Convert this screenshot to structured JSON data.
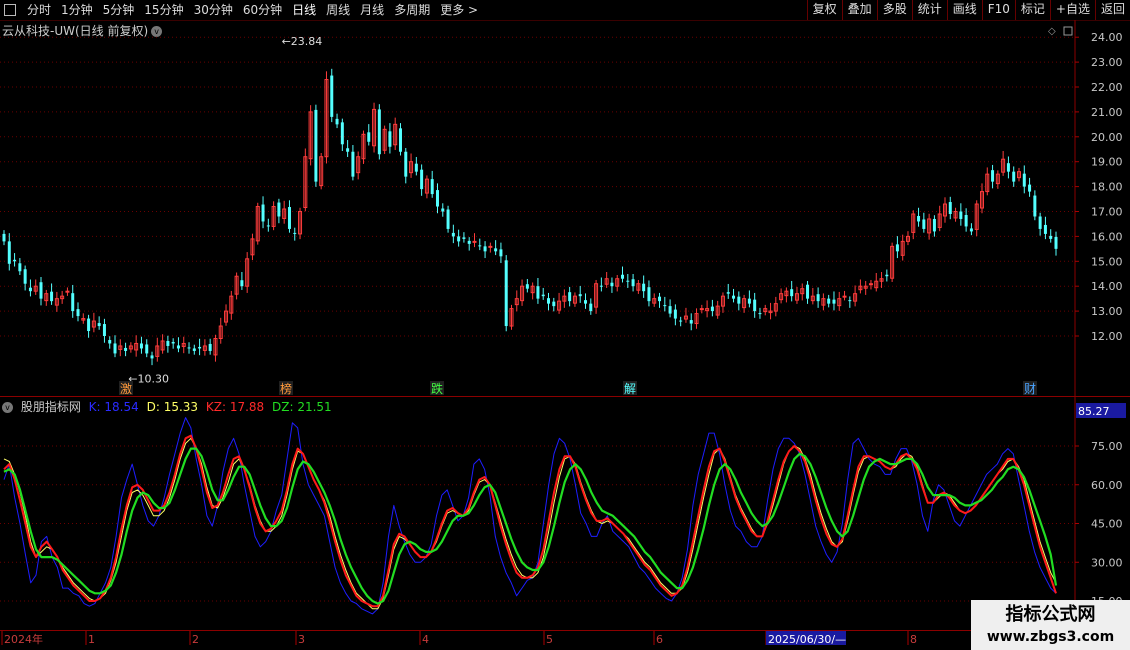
{
  "toolbar": {
    "periods": [
      "分时",
      "1分钟",
      "5分钟",
      "15分钟",
      "30分钟",
      "60分钟",
      "日线",
      "周线",
      "月线",
      "多周期",
      "更多 >"
    ],
    "active_period": "日线",
    "right_buttons": [
      "复权",
      "叠加",
      "多股",
      "统计",
      "画线",
      "F10",
      "标记",
      "+自选",
      "返回"
    ]
  },
  "main_chart": {
    "title": "云从科技-UW(日线 前复权)",
    "high_label": "23.84",
    "low_label": "10.30",
    "event_markers": [
      "激",
      "榜",
      "跌",
      "解",
      "财"
    ]
  },
  "indicator": {
    "name": "股朋指标网",
    "k_label": "K: 18.54",
    "d_label": "D: 15.33",
    "kz_label": "KZ: 17.88",
    "dz_label": "DZ: 21.51",
    "top_value": "85.27"
  },
  "time_axis": {
    "labels": [
      "2024年",
      "1",
      "2",
      "3",
      "4",
      "5",
      "6",
      "2025/06/30/—",
      "8"
    ]
  },
  "watermark": {
    "line1": "指标公式网",
    "line2": "www.zbgs3.com"
  },
  "colors": {
    "up": "#ff3c3c",
    "down": "#54ffff",
    "k": "#1e1eff",
    "d": "#ffff66",
    "kz": "#ff1a1a",
    "dz": "#22dd22"
  },
  "chart_data": [
    {
      "type": "candlestick",
      "title": "云从科技-UW(日线 前复权)",
      "y_ticks": [
        12.0,
        13.0,
        14.0,
        15.0,
        16.0,
        17.0,
        18.0,
        19.0,
        20.0,
        21.0,
        22.0,
        23.0,
        24.0
      ],
      "ylim": [
        10.0,
        24.5
      ],
      "grid": true,
      "annotations": [
        {
          "text": "23.84",
          "value": 23.84,
          "at_index": 51
        },
        {
          "text": "10.30",
          "value": 10.3,
          "at_index": 22
        }
      ],
      "close": [
        15.8,
        14.9,
        15.0,
        14.6,
        14.1,
        13.8,
        14.0,
        13.5,
        13.7,
        13.4,
        13.5,
        13.6,
        13.8,
        13.0,
        12.8,
        12.7,
        12.2,
        12.6,
        12.4,
        12.0,
        11.7,
        11.3,
        11.6,
        11.4,
        11.6,
        11.7,
        11.5,
        11.3,
        11.1,
        11.6,
        11.8,
        11.6,
        11.7,
        11.5,
        11.7,
        11.5,
        11.4,
        11.5,
        11.6,
        11.4,
        11.9,
        12.4,
        13.0,
        13.6,
        14.4,
        14.0,
        15.1,
        15.9,
        17.2,
        16.6,
        16.4,
        17.2,
        16.8,
        17.1,
        16.3,
        16.1,
        17.0,
        19.2,
        21.0,
        18.2,
        19.2,
        22.3,
        20.8,
        20.5,
        19.7,
        19.4,
        18.4,
        19.2,
        20.1,
        19.8,
        21.1,
        19.3,
        20.3,
        19.6,
        20.5,
        19.4,
        18.4,
        19.0,
        18.6,
        17.9,
        18.3,
        17.7,
        17.2,
        17.0,
        16.3,
        16.0,
        15.8,
        15.9,
        15.7,
        15.8,
        15.6,
        15.4,
        15.6,
        15.4,
        15.2,
        12.4,
        13.1,
        13.5,
        14.0,
        13.9,
        14.0,
        13.5,
        13.6,
        13.3,
        13.2,
        13.4,
        13.6,
        13.4,
        13.6,
        13.6,
        13.3,
        13.0,
        14.1,
        14.0,
        14.3,
        14.0,
        14.3,
        14.3,
        14.2,
        14.0,
        14.1,
        13.8,
        13.4,
        13.5,
        13.4,
        13.2,
        12.9,
        12.7,
        12.6,
        12.8,
        12.5,
        12.9,
        13.1,
        13.1,
        13.0,
        13.2,
        13.6,
        13.7,
        13.5,
        13.3,
        13.5,
        13.3,
        13.0,
        12.9,
        13.1,
        13.0,
        13.3,
        13.7,
        13.8,
        13.6,
        13.7,
        13.9,
        13.5,
        13.6,
        13.4,
        13.5,
        13.3,
        13.3,
        13.5,
        13.6,
        13.4,
        13.7,
        14.0,
        14.0,
        14.1,
        14.2,
        14.3,
        14.4,
        15.6,
        15.4,
        15.8,
        16.0,
        16.9,
        16.6,
        16.3,
        16.7,
        16.2,
        16.9,
        17.3,
        16.9,
        17.0,
        16.7,
        16.4,
        16.2,
        17.3,
        17.8,
        18.5,
        18.2,
        18.5,
        19.1,
        18.6,
        18.2,
        18.6,
        18.0,
        17.8,
        16.8,
        16.3,
        16.1,
        15.9,
        15.5
      ]
    },
    {
      "type": "line",
      "title": "股朋指标网",
      "y_ticks": [
        15.0,
        30.0,
        45.0,
        60.0,
        75.0
      ],
      "ylim": [
        8.0,
        85.27
      ],
      "grid": true,
      "series": [
        {
          "name": "K",
          "last": 18.54,
          "values": [
            62,
            68,
            55,
            45,
            33,
            22,
            25,
            38,
            40,
            32,
            28,
            20,
            20,
            18,
            17,
            14,
            13,
            14,
            18,
            22,
            28,
            40,
            55,
            62,
            68,
            60,
            52,
            46,
            44,
            48,
            55,
            64,
            72,
            80,
            86,
            82,
            70,
            60,
            48,
            44,
            52,
            65,
            74,
            78,
            72,
            60,
            50,
            40,
            36,
            38,
            42,
            50,
            56,
            70,
            84,
            82,
            68,
            60,
            56,
            52,
            48,
            38,
            28,
            22,
            18,
            15,
            14,
            12,
            11,
            10,
            12,
            22,
            40,
            52,
            44,
            38,
            33,
            30,
            30,
            32,
            37,
            48,
            56,
            58,
            52,
            46,
            48,
            55,
            68,
            70,
            66,
            56,
            40,
            32,
            26,
            22,
            17,
            20,
            23,
            24,
            30,
            45,
            60,
            72,
            78,
            76,
            70,
            60,
            49,
            45,
            40,
            40,
            45,
            48,
            42,
            40,
            38,
            36,
            32,
            28,
            26,
            23,
            20,
            18,
            16,
            15,
            18,
            24,
            35,
            52,
            64,
            72,
            80,
            80,
            72,
            60,
            50,
            44,
            42,
            38,
            36,
            36,
            40,
            54,
            66,
            74,
            78,
            78,
            76,
            72,
            64,
            54,
            44,
            38,
            33,
            30,
            34,
            45,
            62,
            76,
            78,
            74,
            70,
            68,
            67,
            64,
            64,
            70,
            74,
            74,
            69,
            60,
            48,
            42,
            54,
            60,
            58,
            52,
            46,
            44,
            48,
            52,
            56,
            60,
            64,
            66,
            68,
            72,
            74,
            72,
            62,
            52,
            42,
            34,
            28,
            24,
            20,
            18
          ]
        },
        {
          "name": "D",
          "last": 15.33,
          "values": [
            70,
            69,
            64,
            57,
            48,
            38,
            32,
            34,
            36,
            35,
            32,
            28,
            25,
            22,
            20,
            18,
            16,
            15,
            16,
            18,
            23,
            30,
            40,
            50,
            57,
            58,
            56,
            52,
            48,
            48,
            50,
            55,
            62,
            70,
            76,
            78,
            74,
            68,
            59,
            52,
            51,
            55,
            61,
            68,
            70,
            66,
            60,
            52,
            46,
            42,
            42,
            44,
            48,
            56,
            66,
            73,
            72,
            67,
            62,
            58,
            54,
            48,
            40,
            33,
            27,
            22,
            18,
            16,
            14,
            12,
            12,
            16,
            25,
            35,
            40,
            39,
            37,
            34,
            32,
            32,
            34,
            38,
            44,
            49,
            50,
            49,
            48,
            50,
            56,
            61,
            62,
            60,
            53,
            46,
            39,
            33,
            28,
            25,
            24,
            24,
            26,
            32,
            42,
            53,
            63,
            70,
            71,
            68,
            61,
            55,
            50,
            46,
            45,
            46,
            45,
            43,
            41,
            39,
            36,
            33,
            30,
            28,
            25,
            22,
            20,
            18,
            18,
            20,
            26,
            35,
            45,
            55,
            64,
            72,
            74,
            70,
            63,
            56,
            51,
            47,
            43,
            40,
            40,
            45,
            52,
            60,
            68,
            73,
            75,
            74,
            70,
            64,
            56,
            49,
            43,
            38,
            36,
            38,
            46,
            56,
            65,
            70,
            71,
            70,
            69,
            67,
            66,
            67,
            70,
            72,
            71,
            67,
            60,
            53,
            53,
            55,
            57,
            56,
            53,
            50,
            49,
            50,
            52,
            55,
            58,
            61,
            64,
            66,
            69,
            70,
            67,
            62,
            54,
            46,
            38,
            32,
            26,
            22
          ]
        },
        {
          "name": "KZ",
          "last": 17.88,
          "values": [
            66,
            68,
            62,
            54,
            45,
            36,
            32,
            36,
            38,
            35,
            32,
            27,
            24,
            21,
            19,
            17,
            15,
            15,
            16,
            19,
            24,
            32,
            43,
            52,
            59,
            60,
            58,
            54,
            50,
            50,
            52,
            57,
            64,
            72,
            78,
            79,
            74,
            66,
            57,
            51,
            52,
            57,
            64,
            70,
            71,
            66,
            59,
            51,
            45,
            42,
            43,
            46,
            50,
            58,
            68,
            74,
            72,
            67,
            62,
            58,
            53,
            46,
            38,
            31,
            25,
            21,
            17,
            15,
            14,
            13,
            13,
            17,
            27,
            37,
            41,
            40,
            37,
            34,
            32,
            32,
            34,
            39,
            45,
            50,
            51,
            49,
            48,
            51,
            57,
            62,
            63,
            60,
            52,
            44,
            37,
            31,
            26,
            24,
            24,
            25,
            28,
            35,
            46,
            57,
            66,
            71,
            71,
            67,
            60,
            54,
            49,
            46,
            46,
            47,
            45,
            43,
            41,
            38,
            35,
            32,
            29,
            27,
            24,
            21,
            19,
            17,
            18,
            21,
            28,
            38,
            48,
            58,
            67,
            73,
            74,
            69,
            62,
            55,
            50,
            46,
            42,
            40,
            40,
            46,
            54,
            62,
            69,
            73,
            75,
            73,
            69,
            62,
            54,
            47,
            41,
            37,
            36,
            39,
            48,
            58,
            67,
            71,
            71,
            70,
            69,
            67,
            66,
            68,
            71,
            72,
            70,
            66,
            59,
            53,
            53,
            56,
            57,
            55,
            52,
            50,
            49,
            50,
            52,
            55,
            58,
            61,
            64,
            67,
            70,
            70,
            66,
            60,
            52,
            44,
            36,
            30,
            24,
            18
          ]
        },
        {
          "name": "DZ",
          "last": 21.51,
          "values": [
            65,
            66,
            64,
            58,
            50,
            42,
            35,
            32,
            32,
            32,
            31,
            29,
            27,
            25,
            23,
            21,
            19,
            18,
            18,
            19,
            21,
            26,
            33,
            42,
            50,
            55,
            57,
            56,
            53,
            51,
            51,
            53,
            58,
            64,
            70,
            74,
            74,
            71,
            65,
            58,
            54,
            54,
            58,
            63,
            67,
            67,
            64,
            58,
            52,
            47,
            44,
            44,
            46,
            51,
            59,
            66,
            69,
            68,
            65,
            61,
            57,
            52,
            46,
            39,
            33,
            28,
            24,
            20,
            17,
            15,
            14,
            15,
            19,
            26,
            33,
            37,
            38,
            37,
            35,
            34,
            34,
            35,
            38,
            42,
            46,
            48,
            48,
            49,
            52,
            56,
            59,
            60,
            57,
            51,
            45,
            39,
            34,
            30,
            28,
            27,
            27,
            30,
            36,
            44,
            53,
            61,
            66,
            68,
            66,
            62,
            57,
            53,
            50,
            49,
            48,
            46,
            44,
            42,
            40,
            37,
            34,
            32,
            29,
            26,
            24,
            22,
            20,
            20,
            23,
            28,
            35,
            43,
            52,
            60,
            66,
            68,
            66,
            62,
            57,
            53,
            49,
            46,
            44,
            45,
            48,
            53,
            59,
            65,
            70,
            72,
            71,
            68,
            63,
            57,
            51,
            46,
            42,
            40,
            42,
            48,
            55,
            62,
            67,
            69,
            70,
            69,
            68,
            68,
            69,
            70,
            70,
            68,
            64,
            59,
            56,
            56,
            56,
            56,
            55,
            53,
            52,
            52,
            53,
            54,
            56,
            58,
            61,
            63,
            66,
            67,
            66,
            63,
            58,
            52,
            46,
            40,
            33,
            21
          ]
        }
      ]
    }
  ]
}
